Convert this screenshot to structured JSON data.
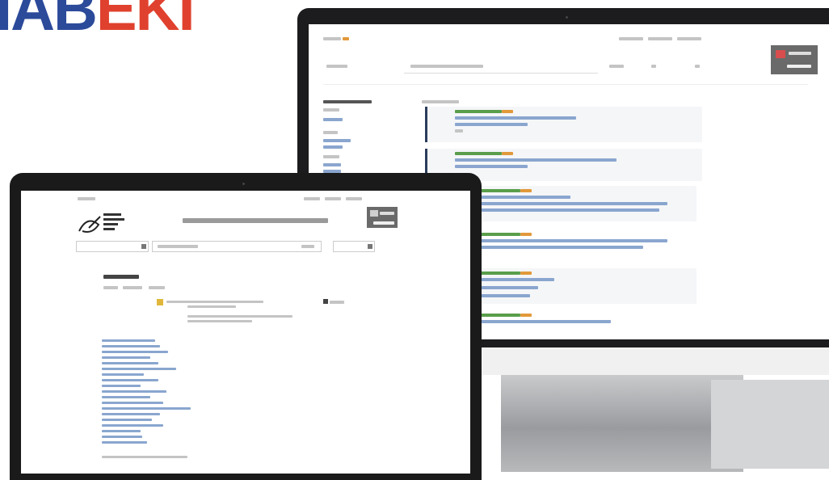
{
  "logo": {
    "text_blue": "IAB",
    "text_red": "EKI",
    "blue": "#2c4a9a",
    "red": "#e0412e"
  },
  "monitor": {
    "brand": "",
    "header_links": [
      "",
      "",
      ""
    ],
    "search_label": "",
    "search_placeholder": "",
    "sidebar_title": "",
    "results_heading": "",
    "button_text": ""
  },
  "laptop": {
    "site_title": "",
    "search_placeholder": "",
    "section_title": "",
    "tabs": [
      "",
      "",
      ""
    ]
  },
  "colors": {
    "frame": "#1c1c1e",
    "link": "#2d5e9e",
    "tag_green": "#5a9e4b",
    "tag_orange": "#e2993a",
    "card_border": "#2b3d5c"
  }
}
